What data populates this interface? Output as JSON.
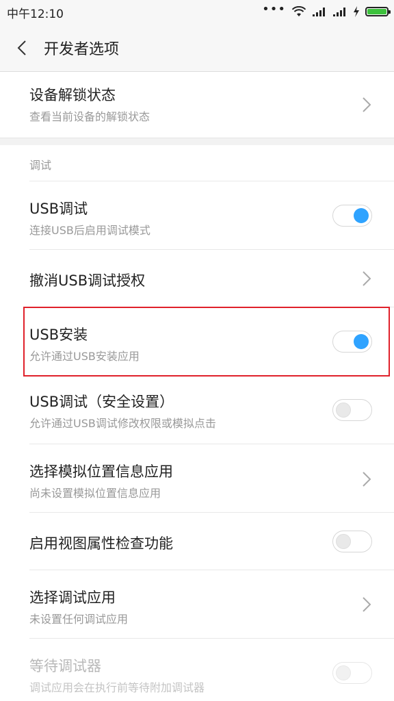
{
  "status_bar": {
    "time": "中午12:10",
    "dots": "•••",
    "battery_level": 1.0,
    "battery_color": "#3cc13c"
  },
  "header": {
    "title": "开发者选项",
    "back_icon": "chevron-left-icon"
  },
  "items": {
    "device_unlock": {
      "title": "设备解锁状态",
      "subtitle": "查看当前设备的解锁状态"
    },
    "section_label": "调试",
    "usb_debug": {
      "title": "USB调试",
      "subtitle": "连接USB后启用调试模式",
      "enabled": true
    },
    "revoke_usb": {
      "title": "撤消USB调试授权"
    },
    "usb_install": {
      "title": "USB安装",
      "subtitle": "允许通过USB安装应用",
      "enabled": true
    },
    "usb_debug_security": {
      "title": "USB调试（安全设置）",
      "subtitle": "允许通过USB调试修改权限或模拟点击",
      "enabled": false
    },
    "mock_location": {
      "title": "选择模拟位置信息应用",
      "subtitle": "尚未设置模拟位置信息应用"
    },
    "view_attr_inspect": {
      "title": "启用视图属性检查功能",
      "enabled": false
    },
    "debug_app": {
      "title": "选择调试应用",
      "subtitle": "未设置任何调试应用"
    },
    "wait_debugger": {
      "title": "等待调试器",
      "subtitle": "调试应用会在执行前等待附加调试器",
      "enabled": false,
      "disabled": true
    }
  },
  "colors": {
    "accent": "#2fa3ff",
    "highlight_border": "#e0202a"
  }
}
